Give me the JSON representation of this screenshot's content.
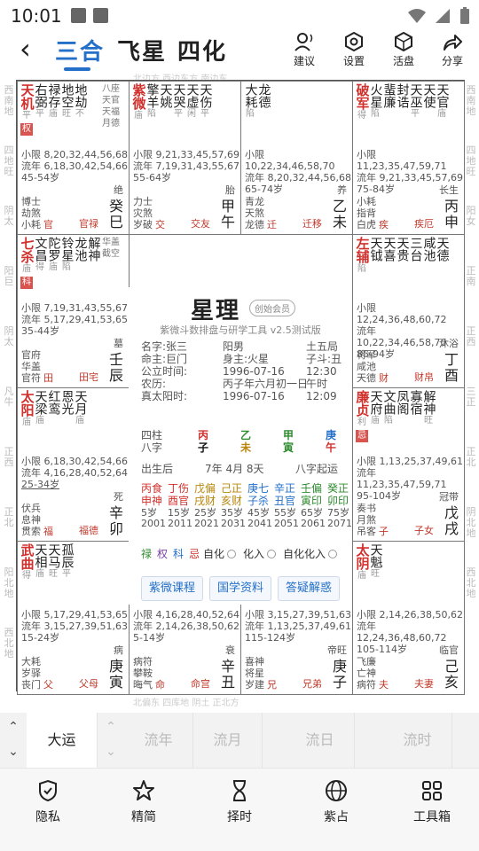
{
  "status": {
    "time": "10:01"
  },
  "nav": {
    "tabs": [
      "三合",
      "飞星",
      "四化"
    ],
    "actions": [
      "建议",
      "设置",
      "活盘",
      "分享"
    ]
  },
  "chart_top_strip": "北边方  西边东方  南边东",
  "outer_left": [
    "西南地",
    "四地旺",
    "阴太",
    "阳巨",
    "阴太",
    "凡牛",
    "正西",
    "正北",
    "阳北地",
    "西北地"
  ],
  "outer_right": [
    "西南地",
    "四地旺",
    "阳女",
    "正南",
    "正西",
    "三正",
    "正北",
    "阴北地",
    "西北地"
  ],
  "cells": [
    {
      "stars": [
        {
          "n": "天机",
          "b": "平",
          "m": true,
          "c": "#d0312d"
        },
        {
          "n": "右弼",
          "b": "平"
        },
        {
          "n": "禄存",
          "b": "庙"
        },
        {
          "n": "地空",
          "b": "旺"
        },
        {
          "n": "地劫",
          "b": "不"
        }
      ],
      "hua": "权",
      "extra": "八座 天官 天福 月德",
      "lines": [
        "小限 8,20,32,44,56,68",
        "流年 6,18,30,42,54,66",
        "45-54岁"
      ],
      "gods": [
        "博士",
        "劫煞",
        "小耗"
      ],
      "gods_r": [
        "绝"
      ],
      "gan": "癸",
      "zhi": "巳",
      "palace": "官禄",
      "palace2": "官"
    },
    {
      "stars": [
        {
          "n": "紫微",
          "b": "庙",
          "m": true,
          "c": "#d0312d"
        },
        {
          "n": "擎羊",
          "b": "陷"
        },
        {
          "n": "天姚",
          "b": ""
        },
        {
          "n": "天哭",
          "b": "平"
        },
        {
          "n": "天虚",
          "b": "闲"
        },
        {
          "n": "天伤",
          "b": "平"
        }
      ],
      "hua": "",
      "extra": "",
      "lines": [
        "小限 9,21,33,45,57,69",
        "流年 7,19,31,43,55,67",
        "55-64岁"
      ],
      "gods": [
        "力士",
        "灾煞",
        "岁破"
      ],
      "gods_r": [
        "胎"
      ],
      "gan": "甲",
      "zhi": "午",
      "palace": "交友",
      "palace2": "交"
    },
    {
      "stars": [
        {
          "n": "大耗",
          "b": "陷"
        },
        {
          "n": "龙德",
          "b": ""
        }
      ],
      "hua": "",
      "extra": "",
      "lines": [
        "小限 10,22,34,46,58,70",
        "流年 8,20,32,44,56,68",
        "65-74岁"
      ],
      "gods": [
        "青龙",
        "天煞",
        "龙德"
      ],
      "gods_r": [
        "养"
      ],
      "gan": "乙",
      "zhi": "未",
      "palace": "迁移",
      "palace2": "迁"
    },
    {
      "stars": [
        {
          "n": "破军",
          "b": "得",
          "m": true,
          "c": "#d0312d"
        },
        {
          "n": "火星",
          "b": "陷"
        },
        {
          "n": "蜚廉",
          "b": ""
        },
        {
          "n": "封诰",
          "b": ""
        },
        {
          "n": "天巫",
          "b": "平"
        },
        {
          "n": "天使",
          "b": ""
        },
        {
          "n": "天官",
          "b": "庙"
        }
      ],
      "hua": "",
      "extra": "",
      "lines": [
        "小限 11,23,35,47,59,71",
        "流年 9,21,33,45,57,69",
        "75-84岁"
      ],
      "gods": [
        "小耗",
        "指背",
        "白虎"
      ],
      "gods_r": [
        "长生"
      ],
      "gan": "丙",
      "zhi": "申",
      "palace": "疾厄",
      "palace2": "疾"
    },
    {
      "stars": [
        {
          "n": "七杀",
          "b": "庙",
          "m": true,
          "c": "#d0312d"
        },
        {
          "n": "文昌",
          "b": "得"
        },
        {
          "n": "陀罗",
          "b": "庙"
        },
        {
          "n": "铃星",
          "b": "陷"
        },
        {
          "n": "龙池",
          "b": ""
        },
        {
          "n": "解神",
          "b": ""
        }
      ],
      "hua": "科",
      "extra": "华盖 截空",
      "lines": [
        "小限 7,19,31,43,55,67",
        "流年 5,17,29,41,53,65",
        "35-44岁"
      ],
      "gods": [
        "官府",
        "华盖",
        "官符"
      ],
      "gods_r": [
        "墓"
      ],
      "gan": "壬",
      "zhi": "辰",
      "palace": "田宅",
      "palace2": "田"
    },
    {
      "stars": [
        {
          "n": "左辅",
          "b": "陷",
          "m": true,
          "c": "#d0312d"
        },
        {
          "n": "天钺",
          "b": ""
        },
        {
          "n": "天喜",
          "b": ""
        },
        {
          "n": "天贵",
          "b": ""
        },
        {
          "n": "三台",
          "b": ""
        },
        {
          "n": "咸池",
          "b": ""
        },
        {
          "n": "天德",
          "b": ""
        }
      ],
      "hua": "",
      "extra": "",
      "lines": [
        "小限 12,24,36,48,60,72",
        "流年 10,22,34,46,58,70",
        "85-94岁"
      ],
      "gods": [
        "将军",
        "咸池",
        "天德"
      ],
      "gods_r": [
        "沐浴"
      ],
      "gan": "丁",
      "zhi": "酉",
      "palace": "财帛",
      "palace2": "财"
    },
    {
      "stars": [
        {
          "n": "太阳",
          "b": "庙",
          "m": true,
          "c": "#d0312d"
        },
        {
          "n": "天梁",
          "b": "庙"
        },
        {
          "n": "红鸾",
          "b": ""
        },
        {
          "n": "恩光",
          "b": ""
        },
        {
          "n": "天月",
          "b": "庙"
        }
      ],
      "hua": "",
      "extra": "",
      "lines": [
        "小限 6,18,30,42,54,66",
        "流年 4,16,28,40,52,64",
        "25-34岁"
      ],
      "gods": [
        "伏兵",
        "息神",
        "贯索"
      ],
      "gods_r": [
        "死"
      ],
      "gan": "辛",
      "zhi": "卯",
      "palace": "福德",
      "palace2": "福"
    },
    {
      "stars": [
        {
          "n": "廉贞",
          "b": "利",
          "m": true,
          "c": "#d0312d"
        },
        {
          "n": "天府",
          "b": "庙"
        },
        {
          "n": "文曲",
          "b": "陷"
        },
        {
          "n": "凤阁",
          "b": ""
        },
        {
          "n": "寡宿",
          "b": ""
        },
        {
          "n": "解神",
          "b": "旺"
        }
      ],
      "hua": "忌",
      "extra": "",
      "lines": [
        "小限 1,13,25,37,49,61",
        "流年 11,23,35,47,59,71",
        "95-104岁"
      ],
      "gods": [
        "奏书",
        "月煞",
        "吊客"
      ],
      "gods_r": [
        "冠带"
      ],
      "gan": "戊",
      "zhi": "戌",
      "palace": "子女",
      "palace2": "子"
    },
    {
      "stars": [
        {
          "n": "武曲",
          "b": "得",
          "m": true,
          "c": "#d0312d"
        },
        {
          "n": "天相",
          "b": "庙"
        },
        {
          "n": "天马",
          "b": "旺"
        },
        {
          "n": "孤辰",
          "b": "平"
        }
      ],
      "hua": "",
      "extra": "",
      "lines": [
        "小限 5,17,29,41,53,65",
        "流年 3,15,27,39,51,63",
        "15-24岁"
      ],
      "gods": [
        "大耗",
        "岁驿",
        "丧门"
      ],
      "gods_r": [
        "病"
      ],
      "gan": "庚",
      "zhi": "寅",
      "palace": "父母",
      "palace2": "父"
    },
    {
      "stars": [
        {
          "n": "天同",
          "b": "不",
          "m": true,
          "c": "#d0312d"
        },
        {
          "n": "巨门",
          "b": "不"
        },
        {
          "n": "天才",
          "b": ""
        },
        {
          "n": "天寿",
          "b": "平"
        },
        {
          "n": "天空",
          "b": ""
        }
      ],
      "hua": "禄",
      "extra": "",
      "lines": [
        "小限 4,16,28,40,52,64",
        "流年 2,14,26,38,50,62",
        "5-14岁"
      ],
      "gods": [
        "病符",
        "攀鞍",
        "晦气"
      ],
      "gods_r": [
        "衰"
      ],
      "gan": "辛",
      "zhi": "丑",
      "palace": "命宫",
      "palace2": "命"
    },
    {
      "stars": [
        {
          "n": "贪狼",
          "b": "旺",
          "m": true,
          "c": "#d0312d"
        },
        {
          "n": "天喜",
          "b": ""
        },
        {
          "n": "台辅",
          "b": "平"
        },
        {
          "n": "解神",
          "b": ""
        },
        {
          "n": "天厨",
          "b": "庙"
        }
      ],
      "hua": "",
      "extra": "",
      "lines": [
        "小限 3,15,27,39,51,63",
        "流年 1,13,25,37,49,61",
        "115-124岁"
      ],
      "gods": [
        "喜神",
        "将星",
        "岁建"
      ],
      "gods_r": [
        "帝旺"
      ],
      "gan": "庚",
      "zhi": "子",
      "palace": "兄弟",
      "palace2": "兄"
    },
    {
      "stars": [
        {
          "n": "太阴",
          "b": "庙",
          "m": true,
          "c": "#d0312d"
        },
        {
          "n": "天魁",
          "b": "旺"
        }
      ],
      "hua": "",
      "extra": "",
      "lines": [
        "小限 2,14,26,38,50,62",
        "流年 12,24,36,48,60,72",
        "105-114岁"
      ],
      "gods": [
        "飞廉",
        "亡神",
        "病符"
      ],
      "gods_r": [
        "临官"
      ],
      "gan": "己",
      "zhi": "亥",
      "palace": "夫妻",
      "palace2": "夫"
    }
  ],
  "center": {
    "title": "星理",
    "member": "创始会员",
    "subtitle": "紫微斗数排盘与研学工具 v2.5测试版",
    "info": [
      [
        "名字:张三",
        "阳男",
        "土五局"
      ],
      [
        "命主:巨门",
        "身主:火星",
        "子斗:丑"
      ],
      [
        "公立时间:",
        "1996-07-16",
        "12:30"
      ],
      [
        "农历:",
        "丙子年六月初一日",
        "午时"
      ],
      [
        "真太阳时:",
        "1996-07-16",
        "12:09"
      ]
    ],
    "sizhu_label": "四柱",
    "bazi_label": "八字",
    "pillars": [
      {
        "g": "丙",
        "z": "子",
        "gc": "#d0312d",
        "zc": "#111"
      },
      {
        "g": "乙",
        "z": "未",
        "gc": "#2e8b2e",
        "zc": "#b8860b"
      },
      {
        "g": "甲",
        "z": "寅",
        "gc": "#2e8b2e",
        "zc": "#2e8b2e"
      },
      {
        "g": "庚",
        "z": "午",
        "gc": "#2470c9",
        "zc": "#d0312d"
      }
    ],
    "birth_label": "出生后",
    "birth_value": "7年 4月 8天",
    "bazi_start": "八字起运",
    "dayun_gan": [
      "丙食",
      "丁伤",
      "戊偏",
      "己正",
      "庚七",
      "辛正",
      "壬偏",
      "癸正"
    ],
    "dayun_zhi": [
      "申神",
      "酉官",
      "戌财",
      "亥财",
      "子杀",
      "丑官",
      "寅印",
      "卯印"
    ],
    "ages": [
      "5岁",
      "15岁",
      "25岁",
      "35岁",
      "45岁",
      "55岁",
      "65岁",
      "75岁"
    ],
    "years": [
      "2001",
      "2011",
      "2021",
      "2031",
      "2041",
      "2051",
      "2061",
      "2071"
    ],
    "hua_legend": [
      "禄",
      "权",
      "科",
      "忌"
    ],
    "hua_colors": [
      "#2e8b2e",
      "#7b3fa0",
      "#2470c9",
      "#d0312d"
    ],
    "radio_opts": [
      "自化",
      "化入",
      "自化化入"
    ],
    "buttons": [
      "紫微课程",
      "国学资料",
      "答疑解惑"
    ]
  },
  "bottom_strip": "北偏东  四库地  阴土  正北方",
  "timebar": [
    "大运",
    "流年",
    "流月",
    "流日",
    "流时"
  ],
  "toolbar": [
    "隐私",
    "精简",
    "择时",
    "紫占",
    "工具箱"
  ]
}
